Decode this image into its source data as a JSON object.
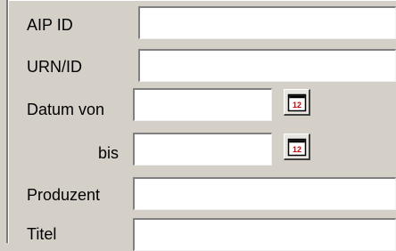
{
  "form": {
    "fields": [
      {
        "label": "AIP ID",
        "value": ""
      },
      {
        "label": "URN/ID",
        "value": ""
      },
      {
        "label": "Datum von",
        "value": ""
      },
      {
        "label": "bis",
        "value": ""
      },
      {
        "label": "Produzent",
        "value": ""
      },
      {
        "label": "Titel",
        "value": ""
      }
    ]
  },
  "icons": {
    "calendar": "calendar-icon"
  },
  "colors": {
    "window_bg": "#d4d0c8",
    "field_bg": "#ffffff",
    "calendar_red": "#cc0000"
  }
}
